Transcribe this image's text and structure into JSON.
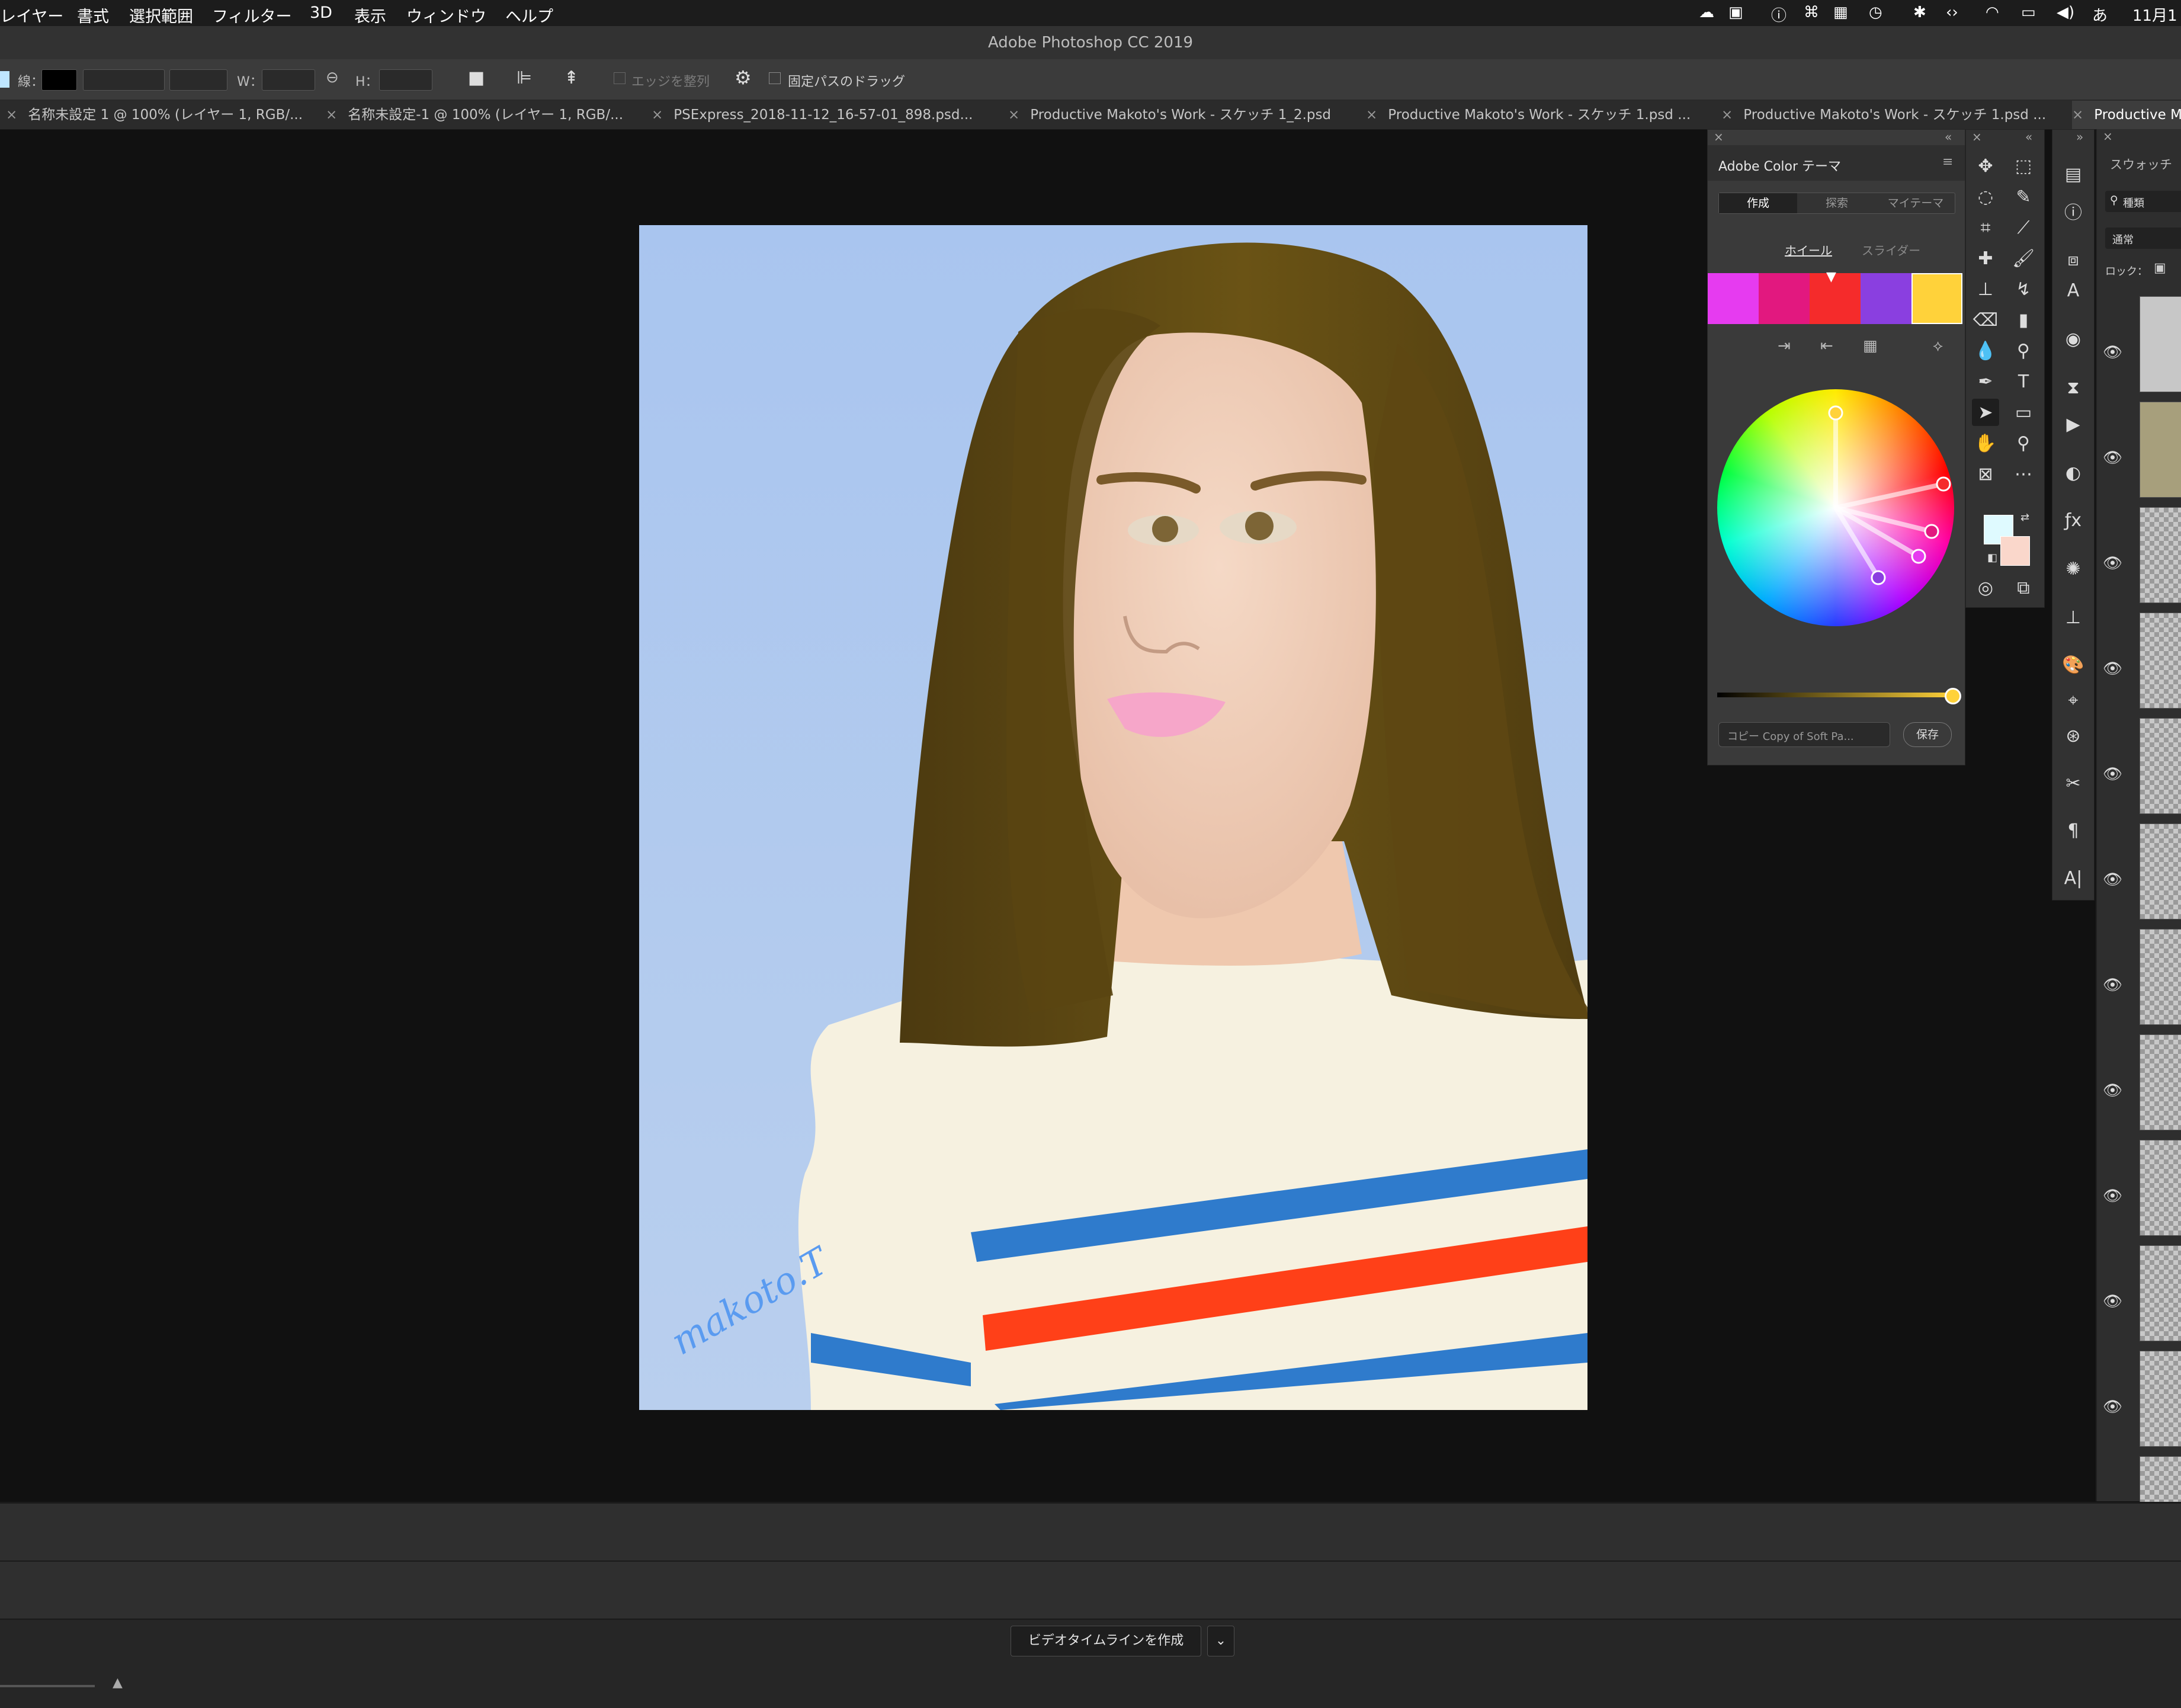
{
  "menubar": {
    "items": [
      "レイヤー",
      "書式",
      "選択範囲",
      "フィルター",
      "3D",
      "表示",
      "ウィンドウ",
      "ヘルプ"
    ],
    "clock": "11月1"
  },
  "window": {
    "title": "Adobe Photoshop CC 2019"
  },
  "options": {
    "stroke_label": "線：",
    "w_label": "W：",
    "h_label": "H：",
    "align_edges": "エッジを整列",
    "constrain_path": "固定パスのドラッグ"
  },
  "tabs": [
    "名称未設定 1 @ 100% (レイヤー 1, RGB/...",
    "名称未設定-1 @ 100% (レイヤー 1, RGB/...",
    "PSExpress_2018-11-12_16-57-01_898.psd...",
    "Productive Makoto's Work - スケッチ 1_2.psd",
    "Productive Makoto's Work - スケッチ 1.psd ...",
    "Productive Makoto's Work - スケッチ 1.psd ...",
    "Productive M"
  ],
  "artwork": {
    "signature": "makoto.T"
  },
  "color_panel": {
    "title": "Adobe Color テーマ",
    "subtabs": [
      "作成",
      "探索",
      "マイテーマ"
    ],
    "modes": [
      "ホイール",
      "スライダー"
    ],
    "swatches": [
      "#e63bf0",
      "#e2187f",
      "#f52b2b",
      "#8a3fe0",
      "#ffd23a"
    ],
    "name_placeholder": "コピー Copy of Soft Pa...",
    "save": "保存"
  },
  "layers_panel": {
    "tab": "スウォッチ",
    "kind_search": "種類",
    "blend": "通常",
    "lock": "ロック："
  },
  "timeline": {
    "create_button": "ビデオタイムラインを作成"
  }
}
